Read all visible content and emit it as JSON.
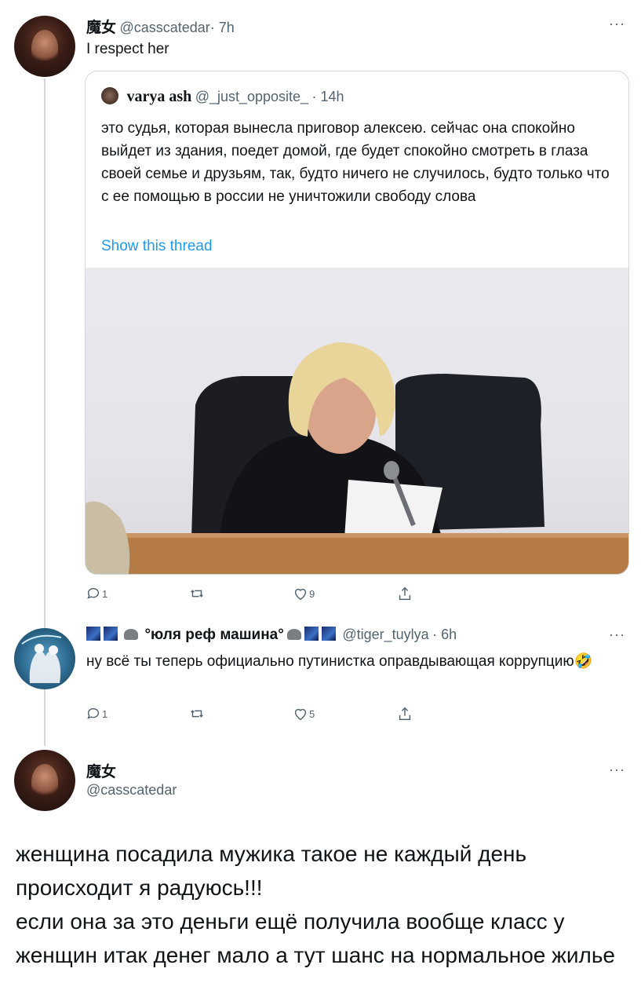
{
  "tweet1": {
    "name": "魔女",
    "handle": "@casscatedar",
    "time": "· 7h",
    "text": "I respect her",
    "more": "···"
  },
  "quote": {
    "name": "varya ash",
    "handle": "@_just_opposite_",
    "time": "· 14h",
    "text": "это судья, которая вынесла приговор алексею. сейчас она спокойно выйдет из здания, поедет домой, где будет спокойно смотреть в глаза своей семье и друзьям, так, будто ничего не случилось, будто только что с ее помощью в россии не уничтожили свободу слова",
    "show_thread": "Show this thread",
    "photo_alt": "judge reading at a desk"
  },
  "actions1": {
    "reply": "1",
    "retweet": "",
    "like": "9",
    "share": ""
  },
  "tweet2": {
    "name": "°юля реф машина°",
    "handle": "@tiger_tuylya",
    "time": "· 6h",
    "text": "ну всё ты теперь официально путинистка оправдывающая коррупцию",
    "emoji": "🤣",
    "more": "···"
  },
  "actions2": {
    "reply": "1",
    "retweet": "",
    "like": "5",
    "share": ""
  },
  "tweet3": {
    "name": "魔女",
    "handle": "@casscatedar",
    "more": "···",
    "line1": "женщина посадила мужика такое не каждый день происходит я радуюсь!!!",
    "line2": "если она за это деньги ещё получила вообще класс у женщин итак денег мало а тут шанс на нормальное жилье"
  },
  "colors": {
    "accent": "#1d9bf0",
    "muted": "#536471",
    "border": "#cfd9de"
  },
  "icons": [
    "reply-icon",
    "retweet-icon",
    "like-icon",
    "share-icon",
    "more-icon"
  ]
}
